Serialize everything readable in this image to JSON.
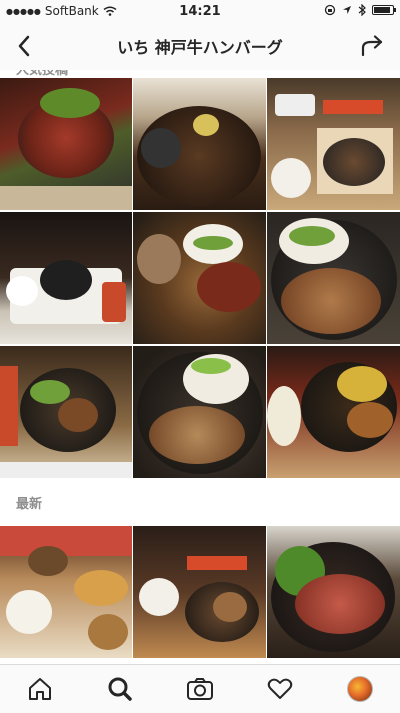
{
  "status_bar": {
    "carrier": "SoftBank",
    "time": "14:21"
  },
  "header": {
    "title": "いち 神戸牛ハンバーグ",
    "back_icon": "chevron-left-icon",
    "share_icon": "share-arrow-icon"
  },
  "sections": {
    "top_posts_label": "人気投稿",
    "recent_label": "最新"
  },
  "tabs": [
    {
      "name": "home",
      "icon": "home-icon"
    },
    {
      "name": "search",
      "icon": "search-icon"
    },
    {
      "name": "camera",
      "icon": "camera-icon"
    },
    {
      "name": "activity",
      "icon": "heart-icon"
    },
    {
      "name": "profile",
      "icon": "avatar"
    }
  ],
  "colors": {
    "accent": "#262626",
    "divider": "#dbdbdb",
    "muted": "#8e8e8e"
  }
}
